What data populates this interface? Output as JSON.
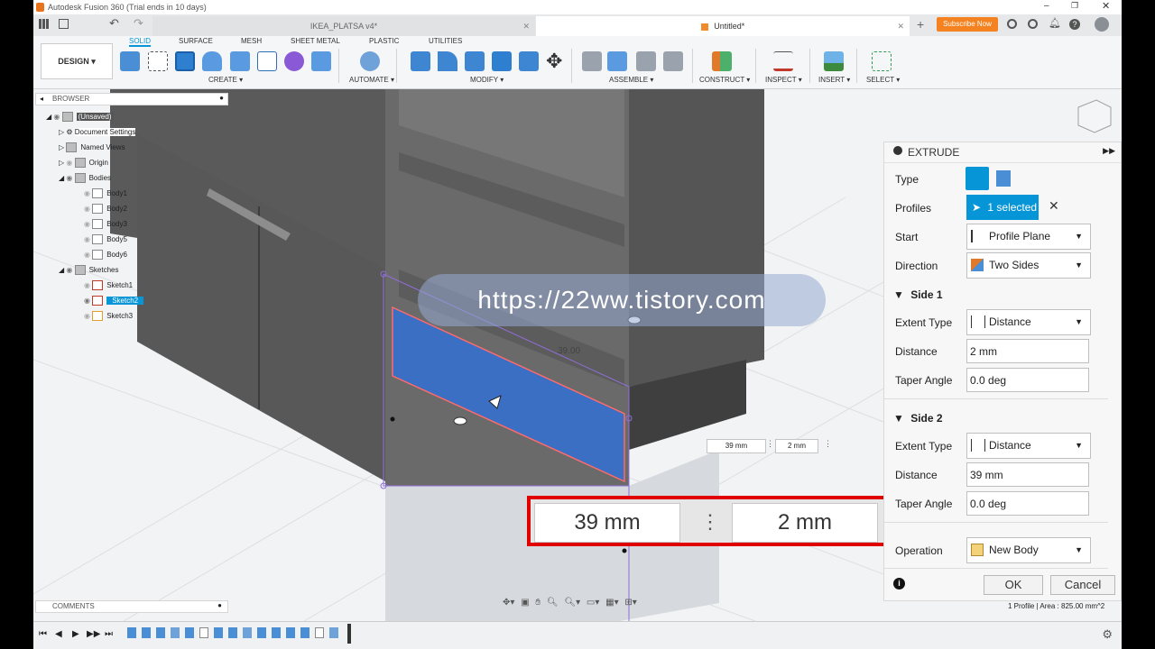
{
  "app": {
    "title": "Autodesk Fusion 360 (Trial ends in 10 days)",
    "tabs": [
      {
        "label": "IKEA_PLATSA v4*"
      },
      {
        "label": "Untitled*"
      }
    ],
    "subscribe_label": "Subscribe Now"
  },
  "toolbar": {
    "workspace": "DESIGN",
    "tabs": [
      "SOLID",
      "SURFACE",
      "MESH",
      "SHEET METAL",
      "PLASTIC",
      "UTILITIES"
    ],
    "groups": [
      "CREATE",
      "AUTOMATE",
      "MODIFY",
      "ASSEMBLE",
      "CONSTRUCT",
      "INSPECT",
      "INSERT",
      "SELECT"
    ]
  },
  "browser": {
    "title": "BROWSER",
    "items": [
      {
        "label": "(Unsaved)"
      },
      {
        "label": "Document Settings"
      },
      {
        "label": "Named Views"
      },
      {
        "label": "Origin"
      },
      {
        "label": "Bodies"
      },
      {
        "label": "Body1"
      },
      {
        "label": "Body2"
      },
      {
        "label": "Body3"
      },
      {
        "label": "Body5"
      },
      {
        "label": "Body6"
      },
      {
        "label": "Sketches"
      },
      {
        "label": "Sketch1"
      },
      {
        "label": "Sketch2"
      },
      {
        "label": "Sketch3"
      }
    ]
  },
  "comments": {
    "title": "COMMENTS"
  },
  "viewport": {
    "dimension_label": "39.00",
    "small_dim_1": "39 mm",
    "small_dim_2": "2 mm",
    "watermark": "https://22ww.tistory.com"
  },
  "dim_inputs": {
    "side1": "39 mm",
    "side2": "2 mm"
  },
  "extrude": {
    "title": "EXTRUDE",
    "type_label": "Type",
    "profiles_label": "Profiles",
    "profiles_value": "1 selected",
    "start_label": "Start",
    "start_value": "Profile Plane",
    "direction_label": "Direction",
    "direction_value": "Two Sides",
    "side1_title": "Side 1",
    "side1_extent_label": "Extent Type",
    "side1_extent_value": "Distance",
    "side1_distance_label": "Distance",
    "side1_distance_value": "2 mm",
    "side1_taper_label": "Taper Angle",
    "side1_taper_value": "0.0 deg",
    "side2_title": "Side 2",
    "side2_extent_label": "Extent Type",
    "side2_extent_value": "Distance",
    "side2_distance_label": "Distance",
    "side2_distance_value": "39 mm",
    "side2_taper_label": "Taper Angle",
    "side2_taper_value": "0.0 deg",
    "operation_label": "Operation",
    "operation_value": "New Body",
    "ok_label": "OK",
    "cancel_label": "Cancel"
  },
  "status": {
    "text": "1 Profile | Area : 825.00 mm^2"
  },
  "colors": {
    "accent": "#0696d7",
    "selection_blue": "#3a6fc4",
    "highlight_red": "#e00000",
    "subscribe_orange": "#f58220"
  }
}
